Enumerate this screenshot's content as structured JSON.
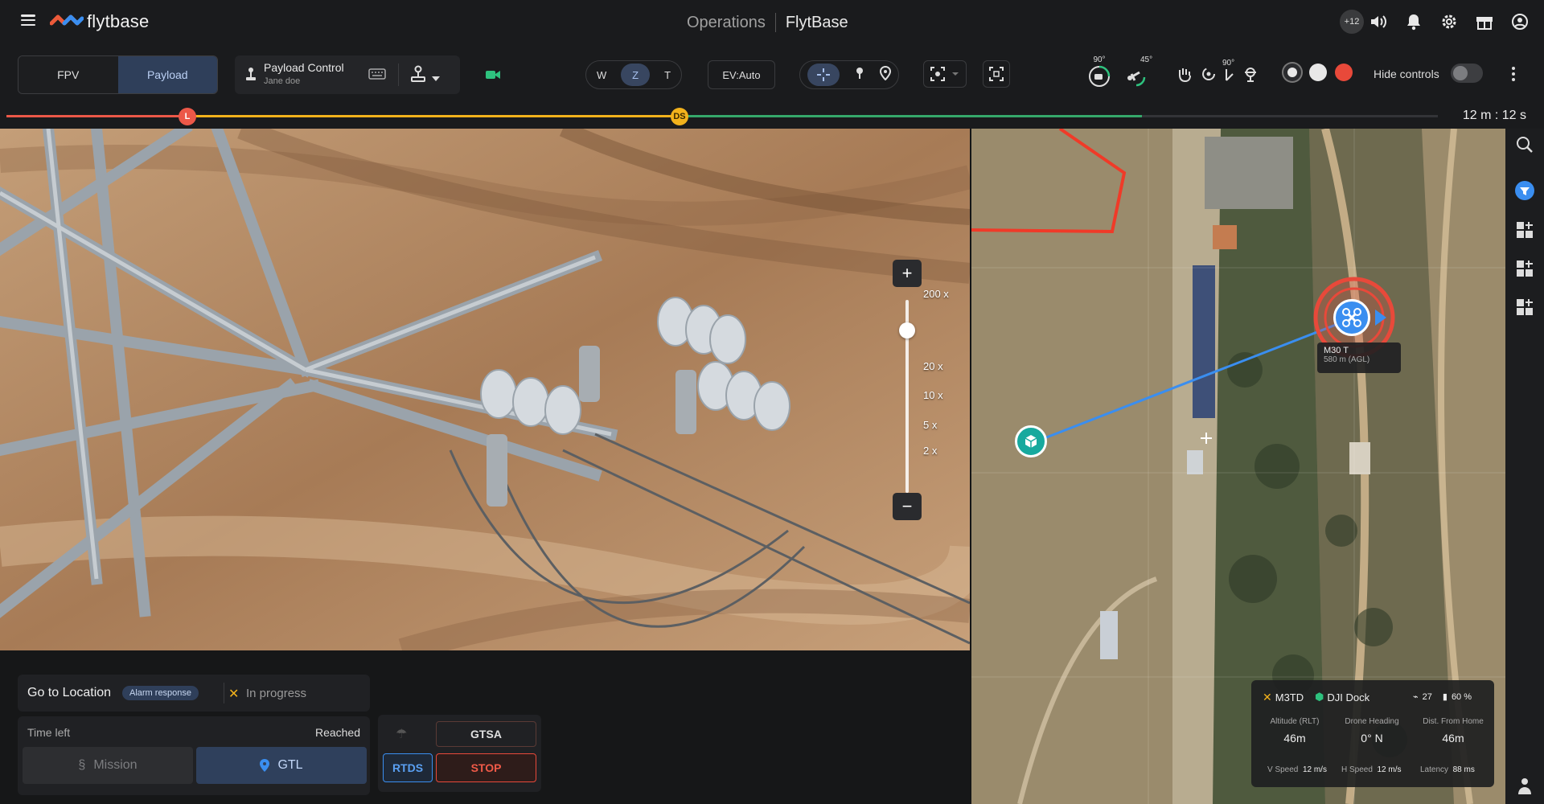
{
  "app": {
    "logo_text": "flytbase",
    "section": "Operations",
    "brand": "FlytBase",
    "notification_count": "+12"
  },
  "toolbar": {
    "tabs": [
      "FPV",
      "Payload"
    ],
    "payload_control": {
      "title": "Payload Control",
      "user": "Jane doe"
    },
    "zoom_modes": [
      "W",
      "Z",
      "T"
    ],
    "ev": "EV:Auto",
    "gimbal_pitch": "90°",
    "gimbal_angle": "45°",
    "tilt_label": "90°",
    "hide_controls": "Hide controls"
  },
  "progress": {
    "marker_l": "L",
    "marker_ds": "DS",
    "time_left": "12 m : 12 s",
    "completed_fraction": 0.78
  },
  "camera": {
    "zoom_levels": [
      "200 x",
      "20 x",
      "10 x",
      "5 x",
      "2 x"
    ],
    "plus": "+",
    "minus": "−"
  },
  "map": {
    "drone_label": "M30 T",
    "drone_alt": "580 m (AGL)"
  },
  "telemetry": {
    "drone": "M3TD",
    "dock": "DJI Dock",
    "satellites": "27",
    "battery": "60 %",
    "altitude_label": "Altitude (RLT)",
    "altitude": "46m",
    "heading_label": "Drone Heading",
    "heading": "0° N",
    "dist_label": "Dist. From Home",
    "dist": "46m",
    "vspeed_label": "V Speed",
    "vspeed": "12 m/s",
    "hspeed_label": "H Speed",
    "hspeed": "12 m/s",
    "latency_label": "Latency",
    "latency": "88 ms"
  },
  "mission": {
    "title": "Go to Location",
    "tag": "Alarm response",
    "status": "In progress",
    "time_left_label": "Time left",
    "reached": "Reached",
    "btn_mission": "Mission",
    "btn_gtl": "GTL",
    "btn_gtsa": "GTSA",
    "btn_rtds": "RTDS",
    "btn_stop": "STOP"
  },
  "colors": {
    "accent_blue": "#3a8ef0",
    "danger": "#e8493a",
    "warning": "#f2b21c",
    "success": "#35a86a"
  }
}
